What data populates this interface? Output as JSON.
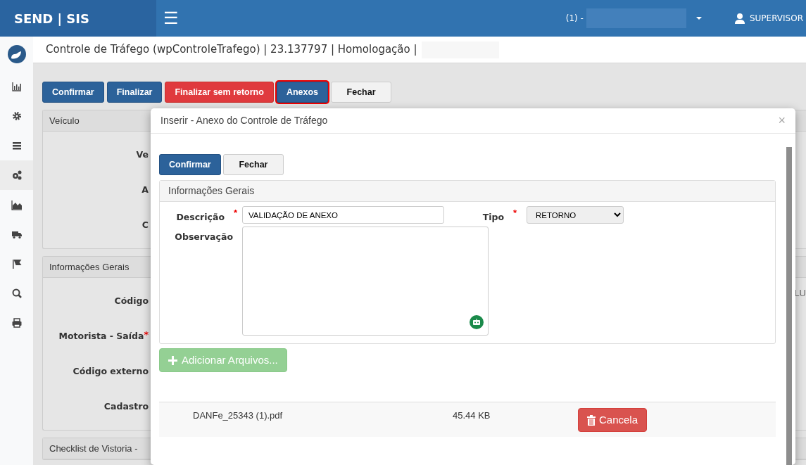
{
  "navbar": {
    "brand": "SEND | SIS",
    "menu_icon": "☰",
    "company": "(1) -",
    "user": "SUPERVISOR"
  },
  "sidebar": {
    "items": [
      {
        "kind": "chart",
        "selected": false
      },
      {
        "kind": "gear",
        "selected": false
      },
      {
        "kind": "list",
        "selected": false
      },
      {
        "kind": "gears",
        "selected": true
      },
      {
        "kind": "area",
        "selected": false
      },
      {
        "kind": "truck",
        "selected": false
      },
      {
        "kind": "flag",
        "selected": false
      },
      {
        "kind": "search",
        "selected": false
      },
      {
        "kind": "print",
        "selected": false
      }
    ]
  },
  "page_title": "Controle de Tráfego (wpControleTrafego) | 23.137797 | Homologação |",
  "toolbar": [
    {
      "label": "Confirmar",
      "kind": "primary",
      "focused": false
    },
    {
      "label": "Finalizar",
      "kind": "primary",
      "focused": false
    },
    {
      "label": "Finalizar sem retorno",
      "kind": "danger",
      "focused": false
    },
    {
      "label": "Anexos",
      "kind": "primary",
      "focused": true
    },
    {
      "label": "Fechar",
      "kind": "default",
      "focused": false
    }
  ],
  "panels": [
    {
      "title": "Veículo",
      "labels": [
        {
          "text": "Ve"
        },
        {
          "text": "A"
        },
        {
          "text": "C"
        }
      ]
    },
    {
      "title": "Informações Gerais",
      "labels": [
        {
          "text": "Código"
        },
        {
          "text": "Motorista - Saída",
          "required_mark": "*"
        },
        {
          "text": "Código externo"
        },
        {
          "text": "Cadastro"
        }
      ],
      "column_2": "LU"
    },
    {
      "title": "Checklist de Vistoria -"
    }
  ],
  "modal": {
    "title": "Inserir - Anexo do Controle de Tráfego",
    "close": "×",
    "buttons": [
      {
        "label": "Confirmar",
        "kind": "primary"
      },
      {
        "label": "Fechar",
        "kind": "default"
      }
    ],
    "section_title": "Informações Gerais",
    "description": {
      "label": "Descrição",
      "required_mark": "*",
      "value": "VALIDAÇÃO DE ANEXO"
    },
    "type": {
      "label": "Tipo",
      "required_mark": "*",
      "value": "RETORNO"
    },
    "observation": {
      "label": "Observação"
    },
    "add_files": {
      "label": "Adicionar Arquivos...",
      "disabled": true
    },
    "files": [
      {
        "name": "DANFe_25343 (1).pdf",
        "size": "45.44 KB",
        "action": "Cancela"
      }
    ]
  }
}
